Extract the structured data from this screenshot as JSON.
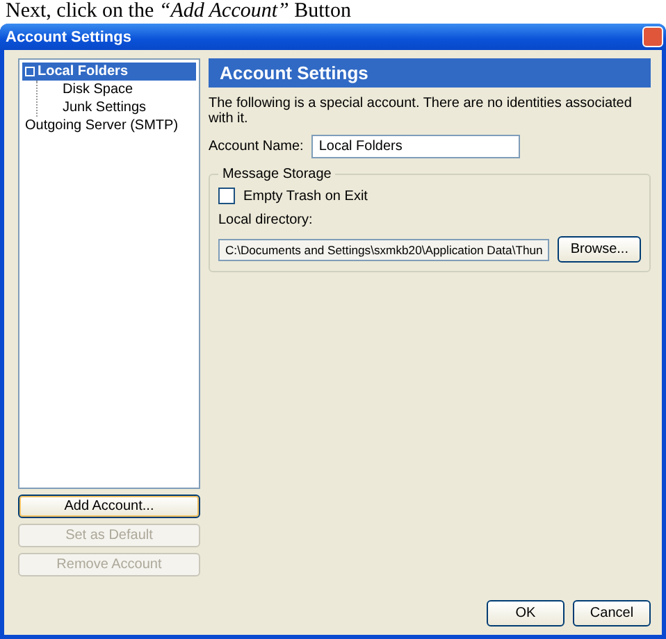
{
  "caption": "Next, click on the *“Add Account”* Button",
  "window": {
    "title": "Account Settings"
  },
  "tree": [
    {
      "label": "Local Folders",
      "selected": true,
      "expanded": true,
      "children": [
        {
          "label": "Disk Space",
          "selected": false
        },
        {
          "label": "Junk Settings",
          "selected": false
        }
      ]
    },
    {
      "label": "Outgoing Server (SMTP)",
      "selected": false
    }
  ],
  "side_buttons": [
    {
      "label": "Add Account...",
      "disabled": false,
      "focused": true
    },
    {
      "label": "Set as Default",
      "disabled": true,
      "focused": false
    },
    {
      "label": "Remove Account",
      "disabled": true,
      "focused": false
    }
  ],
  "panel": {
    "header": "Account Settings",
    "description": "The following is a special account. There are no identities associated with it.",
    "account_name_label": "Account Name:",
    "account_name": "Local Folders",
    "storage": {
      "legend": "Message Storage",
      "checkbox": {
        "label": "Empty Trash on Exit",
        "checked": false
      },
      "directory_label": "Local directory:",
      "directory": "C:\\Documents and Settings\\sxmkb20\\Application Data\\Thun",
      "browse": "Browse..."
    }
  },
  "buttons": [
    "OK",
    "Cancel"
  ]
}
